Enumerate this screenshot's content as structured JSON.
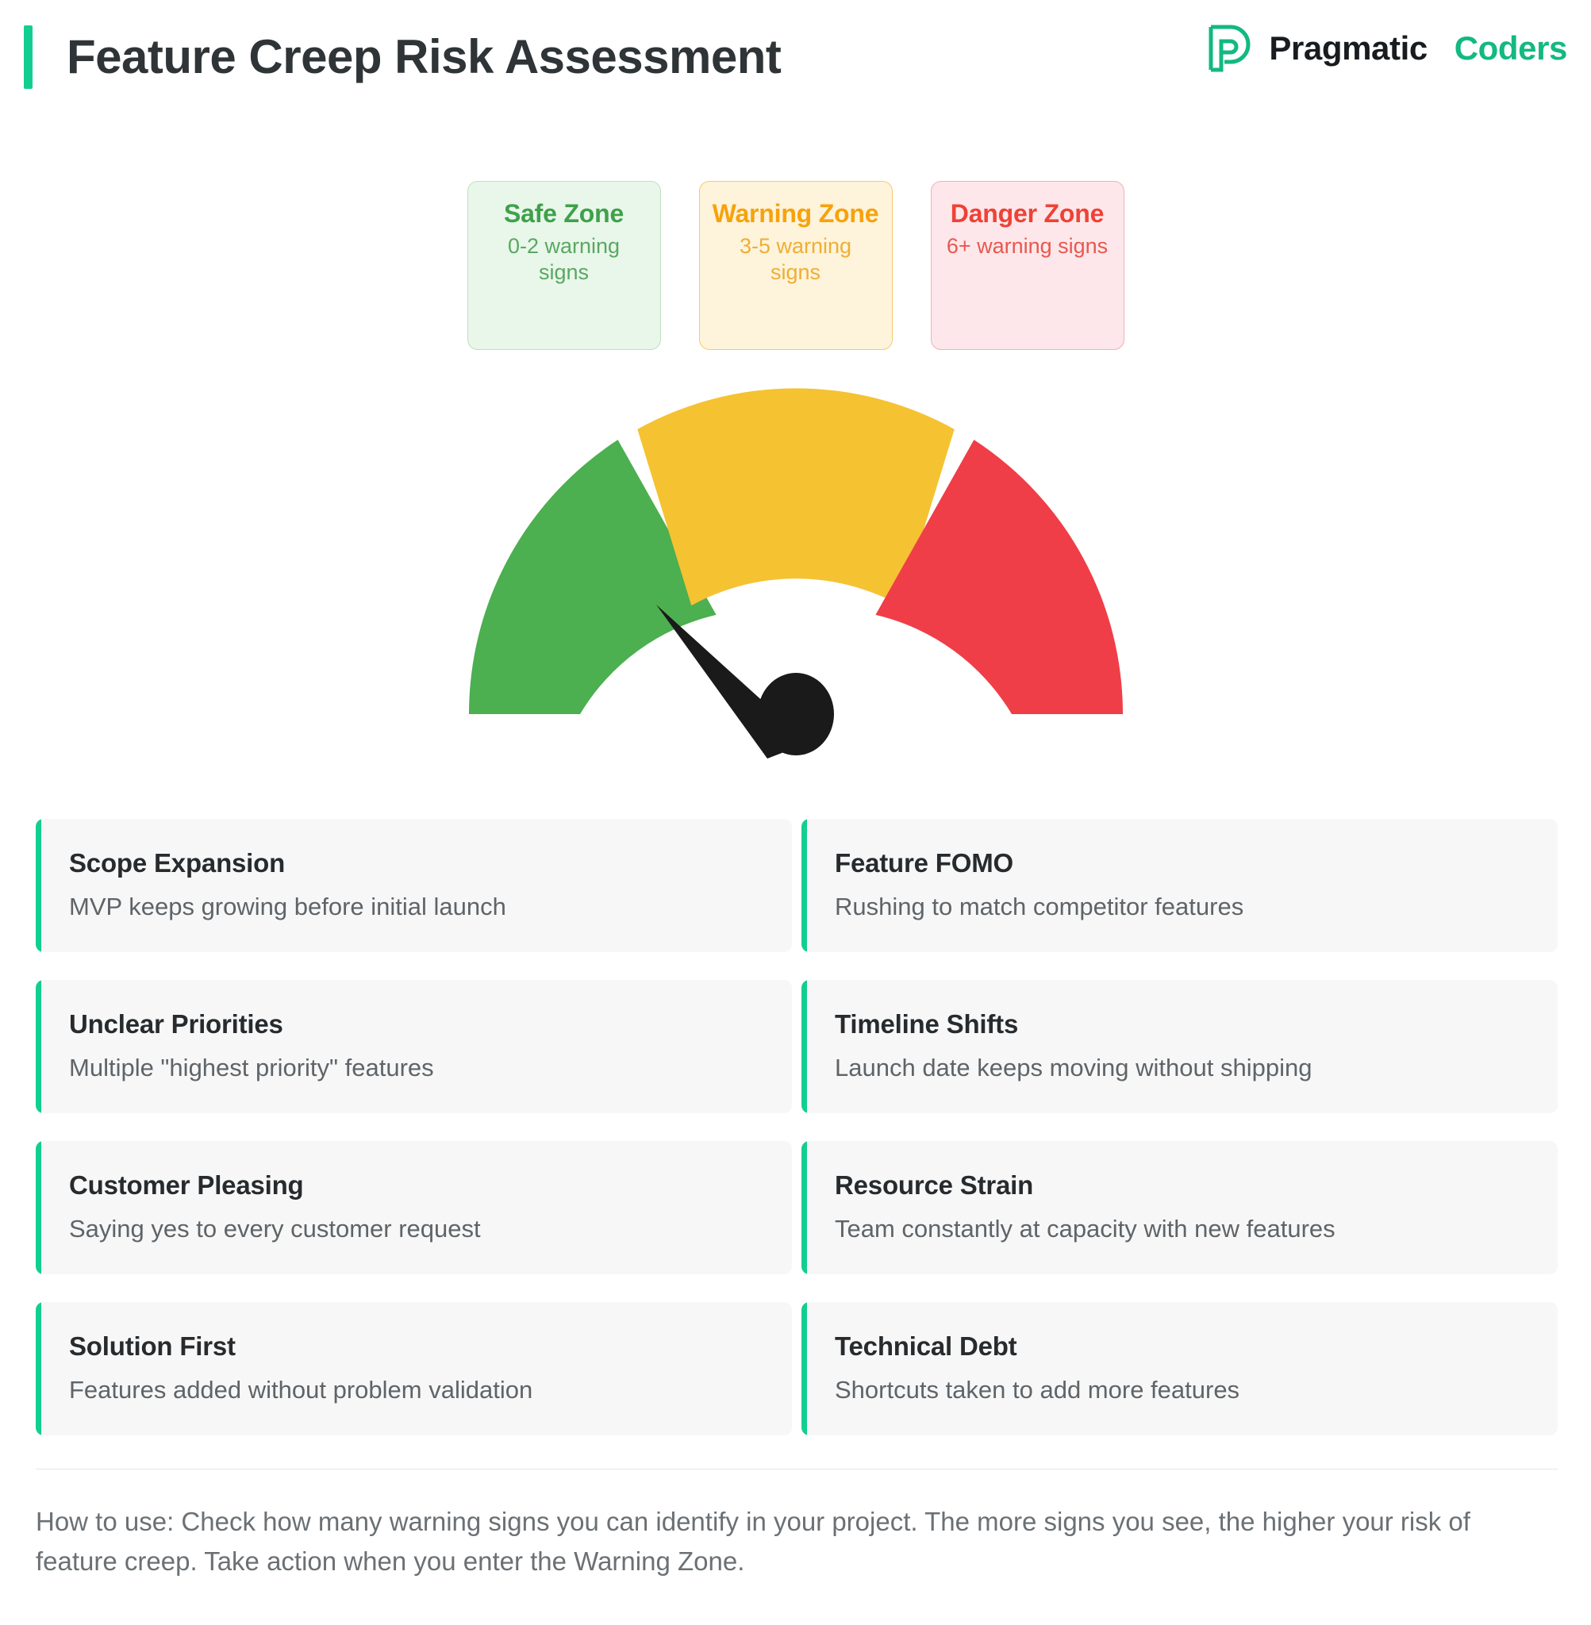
{
  "header": {
    "title": "Feature Creep Risk Assessment",
    "accent_color": "#12CE91",
    "logo": {
      "mark_name": "pragmatic-coders-p-logo",
      "text_primary": "Pragmatic",
      "text_secondary": "Coders",
      "primary_color": "#191C1F",
      "secondary_color": "#12B981"
    }
  },
  "zones": [
    {
      "id": "safe",
      "title": "Safe Zone",
      "subtitle": "0-2 warning signs",
      "bg": "#E9F6EA",
      "border": "#BFE0C2",
      "title_color": "#3EA14A"
    },
    {
      "id": "warning",
      "title": "Warning Zone",
      "subtitle": "3-5 warning signs",
      "bg": "#FEF3DB",
      "border": "#F6C96B",
      "title_color": "#F7A20B"
    },
    {
      "id": "danger",
      "title": "Danger Zone",
      "subtitle": "6+ warning signs",
      "bg": "#FDE7EA",
      "border": "#F3AEB8",
      "title_color": "#EF4136"
    }
  ],
  "chart_data": {
    "type": "gauge",
    "title": "Feature Creep Risk Assessment",
    "segments": [
      {
        "label": "Safe Zone",
        "color": "#4CAF50",
        "start_angle": 180,
        "end_angle": 123
      },
      {
        "label": "Warning Zone",
        "color": "#F5C232",
        "start_angle": 119,
        "end_angle": 61
      },
      {
        "label": "Danger Zone",
        "color": "#EF3E47",
        "start_angle": 57,
        "end_angle": 0
      }
    ],
    "needle": {
      "angle_deg_from_positive_x": 141,
      "points_to_segment": "Safe Zone",
      "color": "#1A1A1A"
    },
    "axis_range": [
      0,
      8
    ],
    "grid": false,
    "legend_position": "above"
  },
  "signs": [
    {
      "title": "Scope Expansion",
      "desc": "MVP keeps growing before initial launch"
    },
    {
      "title": "Feature FOMO",
      "desc": "Rushing to match competitor features"
    },
    {
      "title": "Unclear Priorities",
      "desc": "Multiple \"highest priority\" features"
    },
    {
      "title": "Timeline Shifts",
      "desc": "Launch date keeps moving without shipping"
    },
    {
      "title": "Customer Pleasing",
      "desc": "Saying yes to every customer request"
    },
    {
      "title": "Resource Strain",
      "desc": "Team constantly at capacity with new features"
    },
    {
      "title": "Solution First",
      "desc": "Features added without problem validation"
    },
    {
      "title": "Technical Debt",
      "desc": "Shortcuts taken to add more features"
    }
  ],
  "footer": {
    "note": "How to use: Check how many warning signs you can identify in your project. The more signs you see, the higher your risk of feature creep. Take action when you enter the Warning Zone."
  }
}
